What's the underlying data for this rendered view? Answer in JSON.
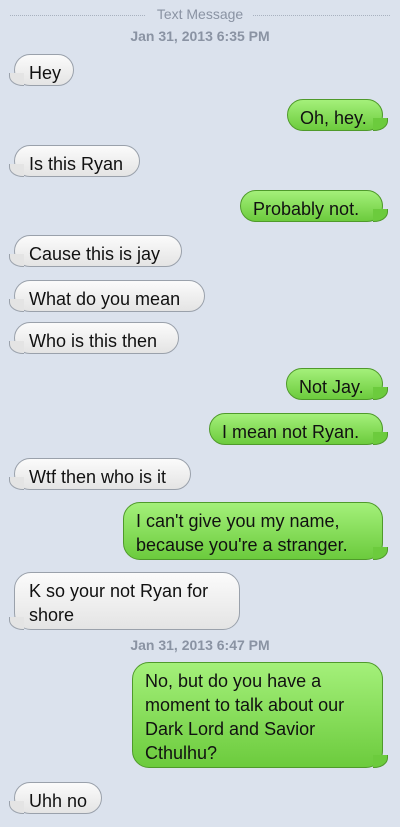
{
  "header": {
    "label": "Text Message",
    "timestamp_1": "Jan 31, 2013 6:35 PM",
    "timestamp_2": "Jan 31, 2013 6:47 PM"
  },
  "messages": [
    {
      "from": "them",
      "text": "Hey"
    },
    {
      "from": "me",
      "text": "Oh, hey."
    },
    {
      "from": "them",
      "text": "Is this Ryan"
    },
    {
      "from": "me",
      "text": "Probably not."
    },
    {
      "from": "them",
      "text": "Cause this is jay"
    },
    {
      "from": "them",
      "text": "What do you mean"
    },
    {
      "from": "them",
      "text": "Who is this then"
    },
    {
      "from": "me",
      "text": "Not Jay."
    },
    {
      "from": "me",
      "text": "I mean not Ryan."
    },
    {
      "from": "them",
      "text": "Wtf then who is it"
    },
    {
      "from": "me",
      "text": "I can't give you my name,\nbecause you're a stranger."
    },
    {
      "from": "them",
      "text": "K so your not Ryan for\nshore"
    },
    {
      "from": "me",
      "text": "No, but do you have a\nmoment to talk about our\nDark Lord and Savior\nCthulhu?"
    },
    {
      "from": "them",
      "text": "Uhh no"
    }
  ],
  "colors": {
    "background": "#dbe2ed",
    "sent_bubble": "#8ee05f",
    "received_bubble": "#f2f2f2"
  }
}
